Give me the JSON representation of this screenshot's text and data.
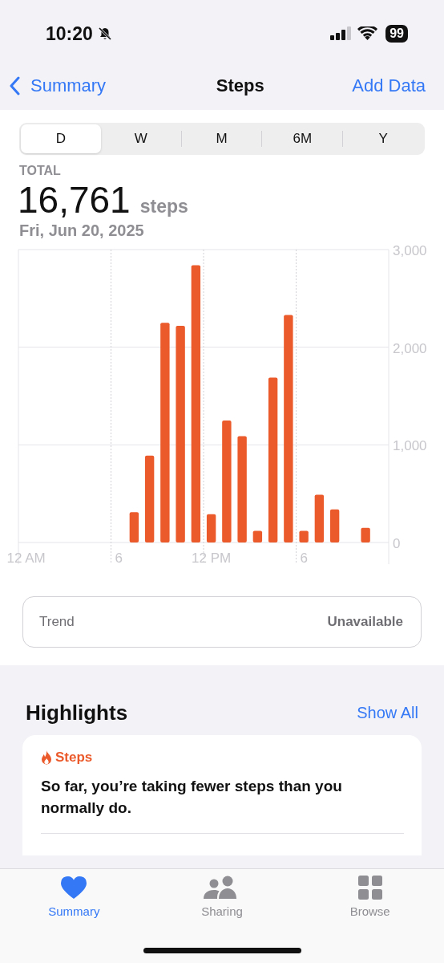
{
  "status_bar": {
    "time": "10:20",
    "battery": "99"
  },
  "nav": {
    "back": "Summary",
    "title": "Steps",
    "action": "Add Data"
  },
  "ranges": [
    {
      "label": "D",
      "selected": true
    },
    {
      "label": "W",
      "selected": false
    },
    {
      "label": "M",
      "selected": false
    },
    {
      "label": "6M",
      "selected": false
    },
    {
      "label": "Y",
      "selected": false
    }
  ],
  "total": {
    "label": "TOTAL",
    "value": "16,761",
    "unit": "steps",
    "date": "Fri, Jun 20, 2025"
  },
  "chart_data": {
    "type": "bar",
    "categories": [
      "12 AM",
      null,
      null,
      null,
      null,
      null,
      "6",
      null,
      null,
      null,
      null,
      null,
      "12 PM",
      null,
      null,
      null,
      null,
      null,
      "6",
      null,
      null,
      null,
      null,
      null
    ],
    "series": [
      {
        "color": "#eb5a2b",
        "values": [
          null,
          null,
          null,
          null,
          null,
          null,
          null,
          310,
          890,
          2250,
          2220,
          2840,
          290,
          1250,
          1090,
          120,
          1690,
          2330,
          120,
          490,
          340,
          null,
          150,
          null
        ]
      }
    ],
    "ylim": [
      0,
      3000
    ],
    "yticks": [
      {
        "value": 0,
        "label": "0"
      },
      {
        "value": 1000,
        "label": "1,000"
      },
      {
        "value": 2000,
        "label": "2,000"
      },
      {
        "value": 3000,
        "label": "3,000"
      }
    ]
  },
  "trend": {
    "label": "Trend",
    "value": "Unavailable"
  },
  "highlights": {
    "title": "Highlights",
    "action": "Show All",
    "card": {
      "category": "Steps",
      "text": "So far, you’re taking fewer steps than you normally do."
    }
  },
  "tabs": [
    {
      "label": "Summary",
      "selected": true
    },
    {
      "label": "Sharing",
      "selected": false
    },
    {
      "label": "Browse",
      "selected": false
    }
  ]
}
